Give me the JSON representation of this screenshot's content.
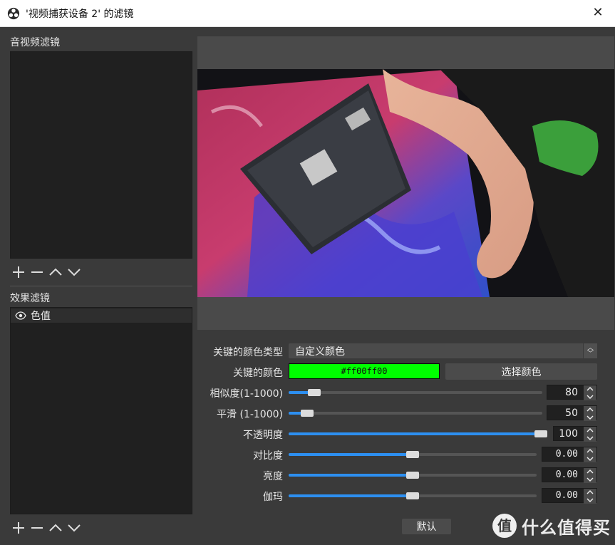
{
  "window": {
    "title": "'视频捕获设备 2' 的滤镜",
    "close_glyph": "✕"
  },
  "audio_video_filters": {
    "label": "音视频滤镜",
    "items": []
  },
  "effect_filters": {
    "label": "效果滤镜",
    "items": [
      {
        "name": "色值",
        "visible": true
      }
    ]
  },
  "properties": {
    "key_color_type": {
      "label": "关键的颜色类型",
      "value": "自定义颜色"
    },
    "key_color": {
      "label": "关键的颜色",
      "value": "#ff00ff00",
      "color": "#00ff00",
      "button_label": "选择颜色"
    },
    "similarity": {
      "label": "相似度(1-1000)",
      "value": "80",
      "slider_fraction": 0.08
    },
    "smoothness": {
      "label": "平滑 (1-1000)",
      "value": "50",
      "slider_fraction": 0.05
    },
    "opacity": {
      "label": "不透明度",
      "value": "100",
      "slider_fraction": 1.0
    },
    "contrast": {
      "label": "对比度",
      "value": "0.00",
      "slider_fraction": 0.5
    },
    "brightness": {
      "label": "亮度",
      "value": "0.00",
      "slider_fraction": 0.5
    },
    "gamma": {
      "label": "伽玛",
      "value": "0.00",
      "slider_fraction": 0.5
    }
  },
  "footer": {
    "default_label": "默认"
  },
  "watermark": {
    "text": "什么值得买"
  },
  "colors": {
    "accent": "#2d8ff0",
    "key_green": "#00ff00",
    "panel": "#202020",
    "background": "#3a3a3a"
  }
}
